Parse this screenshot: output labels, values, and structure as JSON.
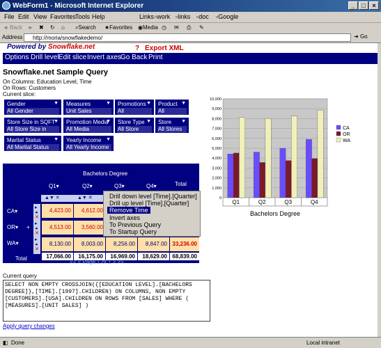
{
  "window": {
    "title": "WebForm1 - Microsoft Internet Explorer"
  },
  "menu": [
    "File",
    "Edit",
    "View",
    "Favorites",
    "Tools",
    "Help"
  ],
  "links_bar": {
    "label": "Links",
    "items": [
      "work",
      "links",
      "doc",
      "Google"
    ]
  },
  "toolbar": {
    "back": "Back",
    "search": "Search",
    "favorites": "Favorites",
    "media": "Media"
  },
  "address": {
    "label": "Address",
    "value": "http://moria/snowflakedemo/",
    "go": "Go"
  },
  "brand": {
    "prefix": "Powered by ",
    "name": "Snowflake.net"
  },
  "help": "?",
  "export": "Export XML",
  "nav": [
    "Options",
    "Drill level",
    "Edit slice",
    "Invert axes",
    "Go Back",
    "Print"
  ],
  "title": "Snowflake.net Sample Query",
  "columns_info": "On Columns: Education Level, Time",
  "rows_info": "On Rows: Customers",
  "current_slice_label": "Current slice:",
  "slices": [
    {
      "name": "Gender",
      "value": "All Gender"
    },
    {
      "name": "Measures",
      "value": "Unit Sales"
    },
    {
      "name": "Promotions",
      "value": "All Promotions"
    },
    {
      "name": "Product",
      "value": "All Products"
    },
    {
      "name": "Store Size in SQFT",
      "value": "All Store Size in SQFT"
    },
    {
      "name": "Promotion Media",
      "value": "All Media"
    },
    {
      "name": "Store Type",
      "value": "All Store Type"
    },
    {
      "name": "Store",
      "value": "All Stores"
    },
    {
      "name": "Marital Status",
      "value": "All Marital Status"
    },
    {
      "name": "Yearly Income",
      "value": "All Yearly Income"
    }
  ],
  "pivot": {
    "group_header": "Bachelors Degree",
    "total_header": "Total",
    "quarters": [
      "Q1",
      "Q2",
      "Q3",
      "Q4"
    ],
    "rows": [
      {
        "label": "CA",
        "values": [
          "4,423.00",
          "4,612.00",
          "",
          ""
        ],
        "total": ""
      },
      {
        "label": "OR",
        "values": [
          "4,513.00",
          "3,560.00",
          "",
          ""
        ],
        "total": ""
      },
      {
        "label": "WA",
        "values": [
          "8,130.00",
          "8,003.00",
          "8,256.00",
          "8,847.00"
        ],
        "total": "33,236.00"
      }
    ],
    "total_row": {
      "label": "Total",
      "values": [
        "17,066.00",
        "16,175.00",
        "16,969.00",
        "18,629.00"
      ],
      "total": "68,839.00"
    },
    "pager": "<< < Page 1 of 1 > >>"
  },
  "context_menu": [
    "Drill down level [Time].[Quarter]",
    "Drill up level [Time].[Quarter]",
    "Remove Time",
    "Invert axes",
    "To Previous Query",
    "To Startup Query"
  ],
  "query": {
    "label": "Current query",
    "text": "SELECT NON EMPTY CROSSJOIN({[EDUCATION LEVEL].[BACHELORS DEGREE]},[TIME].[1997].CHILDREN) ON COLUMNS, NON EMPTY [CUSTOMERS].[USA].CHILDREN ON ROWS FROM [SALES] WHERE ( [MEASURES].[UNIT SALES] )",
    "apply": "Apply query changes"
  },
  "status": {
    "text": "Done",
    "zone": "Local intranet"
  },
  "colors": {
    "nav_bg": "#000080",
    "accent": "#cc0000",
    "ca": "#6a4cff",
    "or": "#7a1a2a",
    "wa": "#f0f0b8"
  },
  "chart_data": {
    "type": "bar",
    "categories": [
      "Q1",
      "Q2",
      "Q3",
      "Q4"
    ],
    "xlabel": "Bachelors Degree",
    "ylim": [
      0,
      10000
    ],
    "yticks": [
      0,
      1000,
      2000,
      3000,
      4000,
      5000,
      6000,
      7000,
      8000,
      9000,
      10000
    ],
    "legend_position": "right",
    "series": [
      {
        "name": "CA",
        "values": [
          4423,
          4612,
          5000,
          5900
        ],
        "color": "#6a4cff"
      },
      {
        "name": "OR",
        "values": [
          4513,
          3560,
          3750,
          3950
        ],
        "color": "#7a1a2a"
      },
      {
        "name": "WA",
        "values": [
          8130,
          8003,
          8256,
          8847
        ],
        "color": "#f0f0b8"
      }
    ]
  }
}
